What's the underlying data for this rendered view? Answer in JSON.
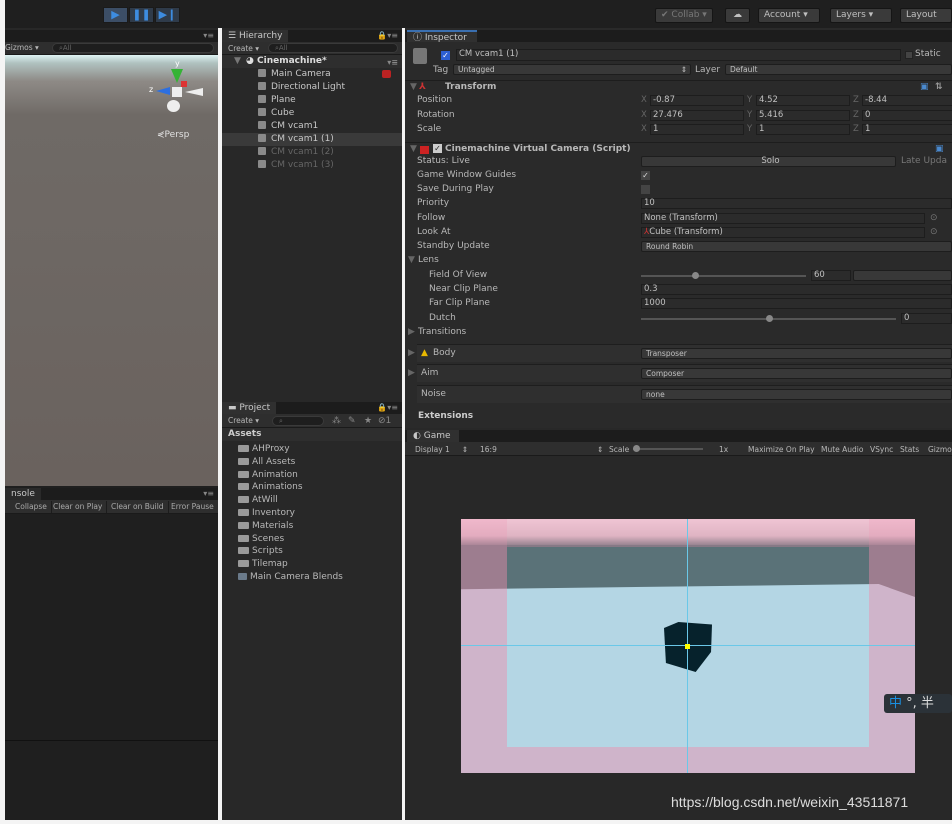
{
  "toolbar": {
    "play_icon": "play-icon",
    "pause_icon": "pause-icon",
    "step_icon": "step-icon",
    "collab": "Collab",
    "account": "Account",
    "layers": "Layers",
    "layout": "Layout"
  },
  "scene": {
    "gizmos": "Gizmos",
    "search": "All",
    "persp": "Persp",
    "axis_y": "y",
    "axis_z": "z"
  },
  "hierarchy": {
    "tab": "Hierarchy",
    "create": "Create",
    "search": "All",
    "scene": "Cinemachine*",
    "items": [
      {
        "label": "Main Camera",
        "enabled": true
      },
      {
        "label": "Directional Light",
        "enabled": true
      },
      {
        "label": "Plane",
        "enabled": true
      },
      {
        "label": "Cube",
        "enabled": true
      },
      {
        "label": "CM vcam1",
        "enabled": true
      },
      {
        "label": "CM vcam1 (1)",
        "enabled": true,
        "selected": true
      },
      {
        "label": "CM vcam1 (2)",
        "enabled": false
      },
      {
        "label": "CM vcam1 (3)",
        "enabled": false
      }
    ]
  },
  "project": {
    "tab": "Project",
    "create": "Create",
    "hidden_count": "1",
    "root": "Assets",
    "items": [
      "AHProxy",
      "All Assets",
      "Animation",
      "Animations",
      "AtWill",
      "Inventory",
      "Materials",
      "Scenes",
      "Scripts",
      "Tilemap",
      "Main Camera Blends"
    ]
  },
  "console": {
    "tab": "nsole",
    "buttons": [
      "Collapse",
      "Clear on Play",
      "Clear on Build",
      "Error Pause"
    ]
  },
  "inspector": {
    "tab": "Inspector",
    "name": "CM vcam1 (1)",
    "static": "Static",
    "tag_label": "Tag",
    "tag": "Untagged",
    "layer_label": "Layer",
    "layer": "Default",
    "transform": {
      "title": "Transform",
      "rows": [
        {
          "label": "Position",
          "x": "-0.87",
          "y": "4.52",
          "z": "-8.44"
        },
        {
          "label": "Rotation",
          "x": "27.476",
          "y": "5.416",
          "z": "0"
        },
        {
          "label": "Scale",
          "x": "1",
          "y": "1",
          "z": "1"
        }
      ]
    },
    "vcam": {
      "title": "Cinemachine Virtual Camera (Script)",
      "status": "Status: Live",
      "solo": "Solo",
      "late_update": "Late Upda",
      "game_window_guides": "Game Window Guides",
      "game_window_guides_checked": true,
      "save_during_play": "Save During Play",
      "save_during_play_checked": false,
      "priority_label": "Priority",
      "priority": "10",
      "follow_label": "Follow",
      "follow": "None (Transform)",
      "look_at_label": "Look At",
      "look_at": "Cube (Transform)",
      "standby_label": "Standby Update",
      "standby": "Round Robin",
      "lens": "Lens",
      "fov_label": "Field Of View",
      "fov": "60",
      "fov_fraction": 0.33,
      "near_label": "Near Clip Plane",
      "near": "0.3",
      "far_label": "Far Clip Plane",
      "far": "1000",
      "dutch_label": "Dutch",
      "dutch": "0",
      "dutch_fraction": 0.5,
      "transitions": "Transitions",
      "body_label": "Body",
      "body": "Transposer",
      "aim_label": "Aim",
      "aim": "Composer",
      "noise_label": "Noise",
      "noise": "none",
      "extensions": "Extensions"
    }
  },
  "game": {
    "tab": "Game",
    "display": "Display 1",
    "aspect": "16:9",
    "scale_label": "Scale",
    "scale": "1x",
    "buttons": [
      "Maximize On Play",
      "Mute Audio",
      "VSync",
      "Stats",
      "Gizmo"
    ]
  },
  "ime": {
    "char": "中",
    "rest": "°, 半"
  },
  "watermark": "https://blog.csdn.net/weixin_43511871"
}
